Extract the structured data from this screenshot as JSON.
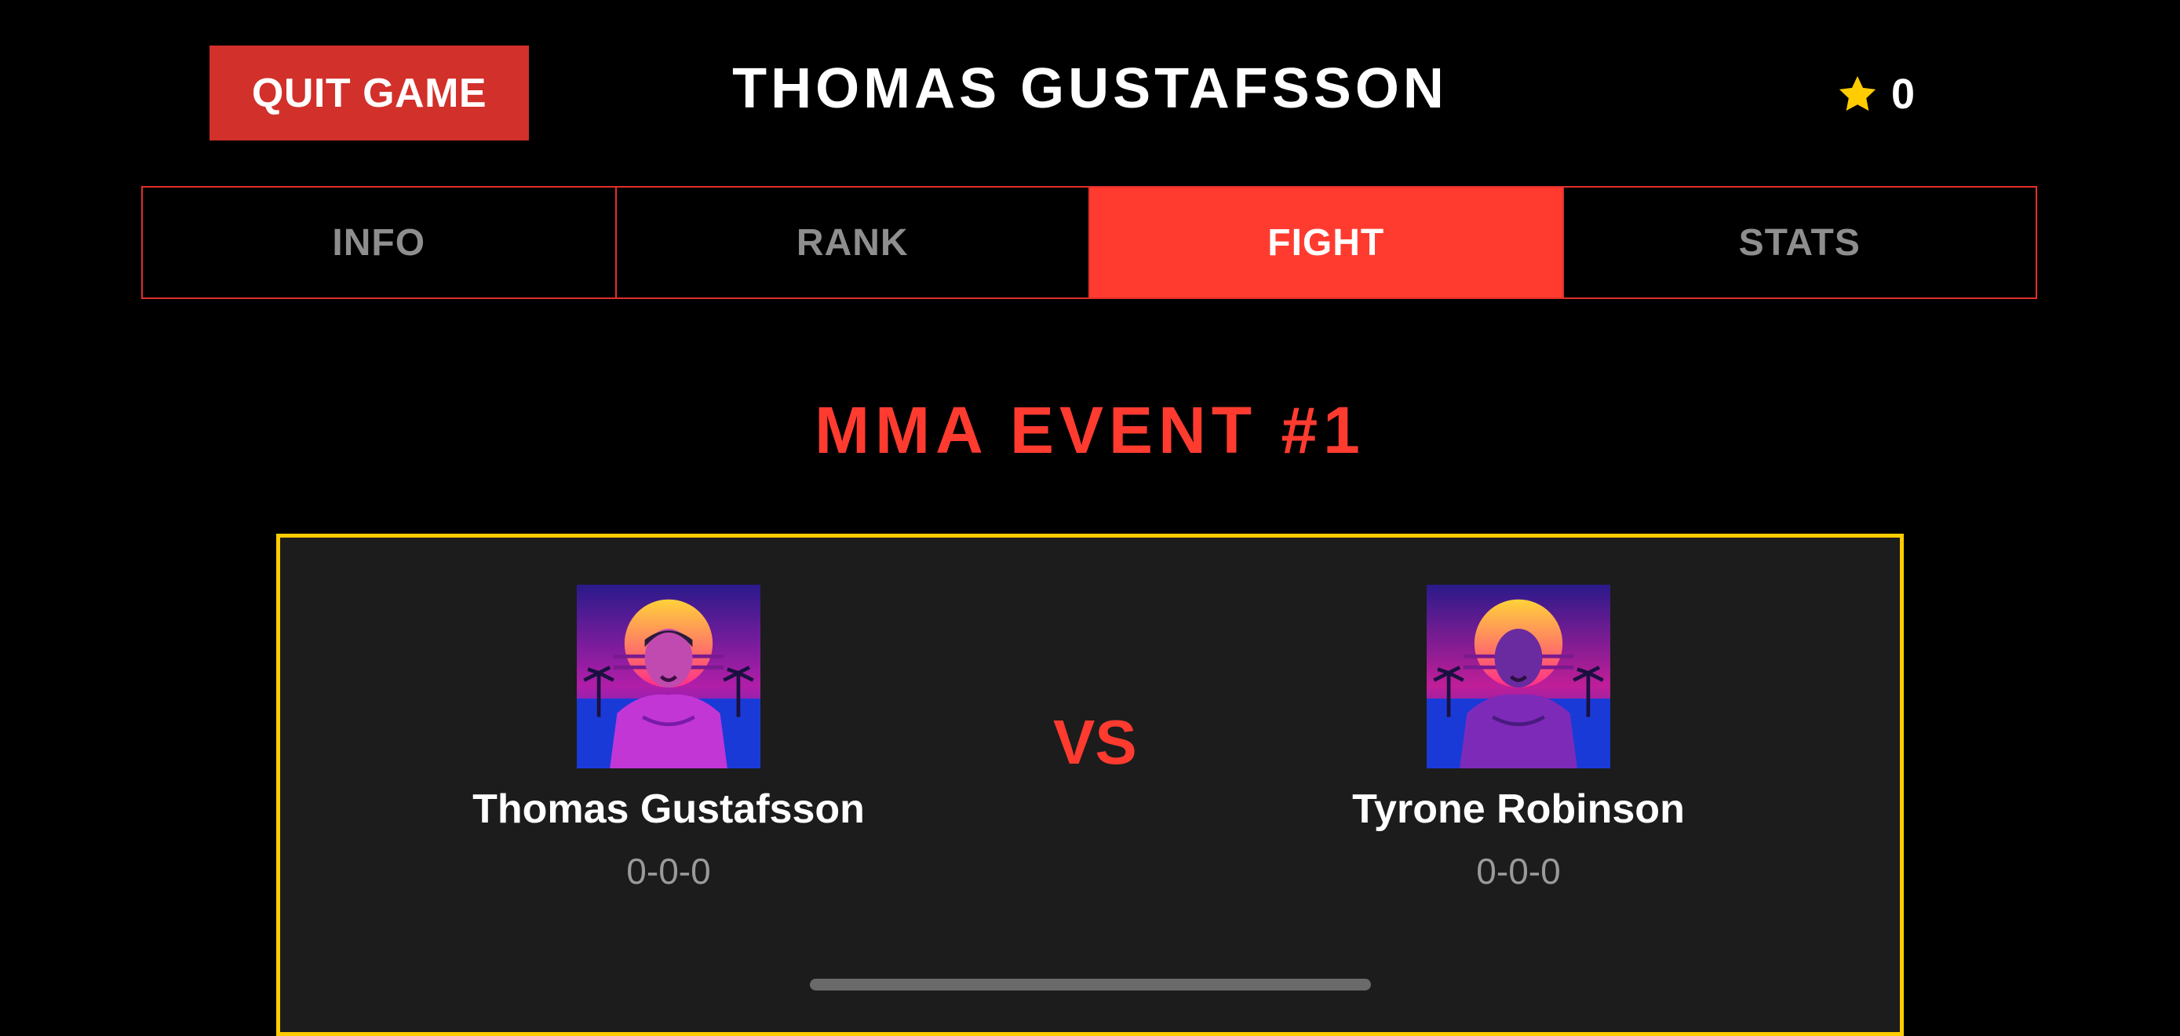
{
  "header": {
    "quit_label": "QUIT GAME",
    "player_name": "THOMAS GUSTAFSSON",
    "score_icon": "star-icon",
    "score": "0"
  },
  "tabs": [
    {
      "label": "INFO",
      "active": false
    },
    {
      "label": "RANK",
      "active": false
    },
    {
      "label": "FIGHT",
      "active": true
    },
    {
      "label": "STATS",
      "active": false
    }
  ],
  "event": {
    "title": "MMA EVENT #1"
  },
  "match": {
    "vs_label": "VS",
    "fighters": [
      {
        "name": "Thomas Gustafsson",
        "record": "0-0-0",
        "portrait": "fighter-portrait-image"
      },
      {
        "name": "Tyrone Robinson",
        "record": "0-0-0",
        "portrait": "fighter-portrait-image"
      }
    ]
  },
  "colors": {
    "accent": "#ff3b30",
    "quit_button": "#d2302a",
    "card_border": "#ffcc00",
    "card_background": "#1c1c1c",
    "star": "#ffcc00"
  }
}
